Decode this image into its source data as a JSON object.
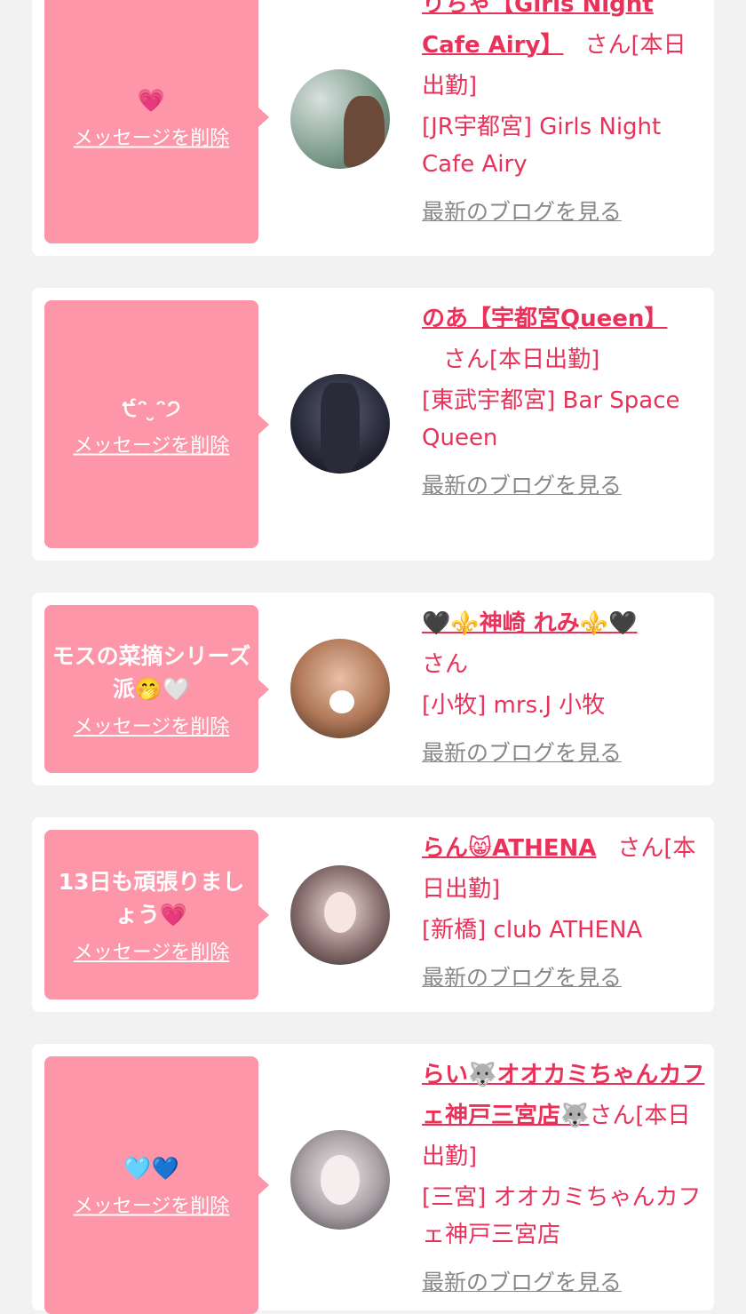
{
  "cards": [
    {
      "message": "💗",
      "delete_label": "メッセージを削除",
      "name": "りちゃ【Girls Night Cafe Airy】",
      "suffix": "さん[本日出勤]",
      "shop": "[JR宇都宮] Girls Night Cafe Airy",
      "blog_label": "最新のブログを見る"
    },
    {
      "message": "੯ᵔ ̮ᵔ੭",
      "delete_label": "メッセージを削除",
      "name": "のあ【宇都宮Queen】",
      "suffix": "さん[本日出勤]",
      "shop": "[東武宇都宮] Bar Space Queen",
      "blog_label": "最新のブログを見る"
    },
    {
      "message": "モスの菜摘シリーズ派🤭🤍",
      "delete_label": "メッセージを削除",
      "name": "🖤⚜️神崎 れみ⚜️🖤",
      "suffix": "さん",
      "shop": "[小牧] mrs.J 小牧",
      "blog_label": "最新のブログを見る"
    },
    {
      "message": "13日も頑張りましょう💗",
      "delete_label": "メッセージを削除",
      "name": "らん😸ATHENA",
      "suffix": "さん[本日出勤]",
      "shop": "[新橋] club ATHENA",
      "blog_label": "最新のブログを見る"
    },
    {
      "message": "🩵💙",
      "delete_label": "メッセージを削除",
      "name": "らい🐺オオカミちゃんカフェ神戸三宮店🐺",
      "suffix": "さん[本日出勤]",
      "shop": "[三宮] オオカミちゃんカフェ神戸三宮店",
      "blog_label": "最新のブログを見る"
    }
  ],
  "colors": {
    "accent": "#e8325a",
    "message_bg": "#fc96a8",
    "page_bg": "#f2f2f2"
  }
}
